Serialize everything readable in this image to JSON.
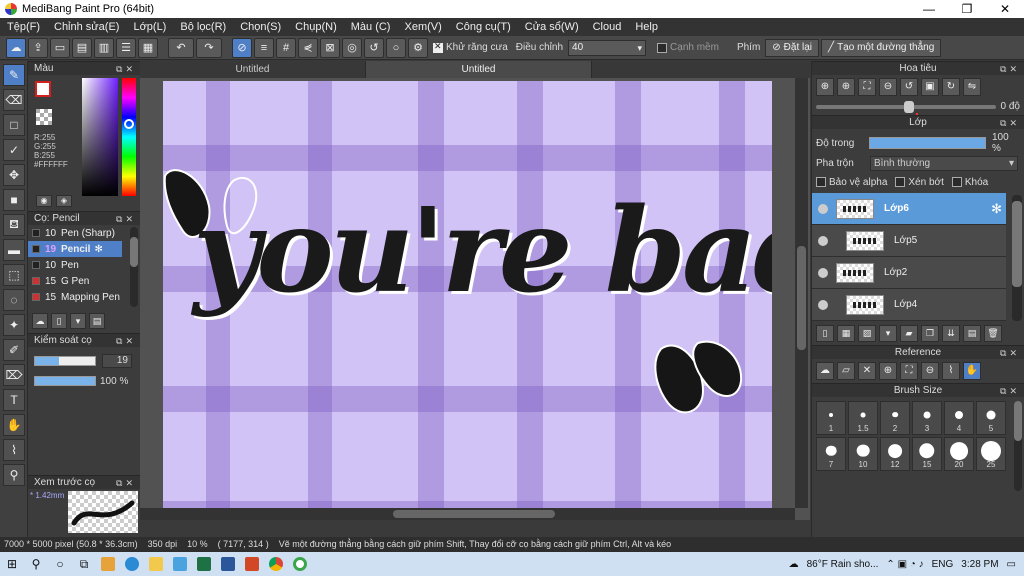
{
  "window": {
    "title": "MediBang Paint Pro (64bit)",
    "controls": [
      "—",
      "❐",
      "✕"
    ]
  },
  "menu": [
    "Tệp(F)",
    "Chỉnh sửa(E)",
    "Lớp(L)",
    "Bộ lọc(R)",
    "Chọn(S)",
    "Chụp(N)",
    "Màu (C)",
    "Xem(V)",
    "Công cụ(T)",
    "Cửa sổ(W)",
    "Cloud",
    "Help"
  ],
  "toolbar": {
    "antialias_label": "Khử răng cưa",
    "adjust_label": "Điều chỉnh",
    "adjust_value": "40",
    "soft_edge_label": "Cạnh mềm",
    "key_label": "Phím",
    "reset_label": "Đặt lại",
    "straight_line_label": "Tạo một đường thẳng"
  },
  "color_panel": {
    "title": "Màu",
    "rgb_r": "R:255",
    "rgb_g": "G:255",
    "rgb_b": "B:255",
    "hex": "#FFFFFF"
  },
  "brush_panel": {
    "title": "Cọ: Pencil",
    "items": [
      {
        "size": "10",
        "name": "Pen (Sharp)",
        "color": "#222222",
        "selected": false
      },
      {
        "size": "19",
        "name": "Pencil",
        "color": "#222222",
        "selected": true
      },
      {
        "size": "10",
        "name": "Pen",
        "color": "#222222",
        "selected": false
      },
      {
        "size": "15",
        "name": "G Pen",
        "color": "#d03030",
        "selected": false
      },
      {
        "size": "15",
        "name": "Mapping Pen",
        "color": "#d03030",
        "selected": false
      }
    ]
  },
  "brush_control": {
    "title": "Kiểm soát cọ",
    "size_value": "19",
    "size_fraction": 0.4,
    "opacity_value": "100 %",
    "opacity_fraction": 1.0
  },
  "preview_panel": {
    "title": "Xem trước cọ",
    "size_text": "* 1.42mm"
  },
  "tabs": [
    "Untitled",
    "Untitled"
  ],
  "canvas": {
    "artwork_text": "you're bad"
  },
  "navigator": {
    "title": "Hoa tiêu",
    "rotation": "0 độ"
  },
  "layer_panel": {
    "title": "Lớp",
    "opacity_label": "Độ trong",
    "opacity_value": "100 %",
    "blend_label": "Pha trộn",
    "blend_value": "Bình thường",
    "protect_alpha": "Bảo vệ alpha",
    "clipping": "Xén bớt",
    "lock": "Khóa",
    "layers": [
      {
        "name": "Lớp6",
        "selected": true,
        "indent": false
      },
      {
        "name": "Lớp5",
        "selected": false,
        "indent": true
      },
      {
        "name": "Lớp2",
        "selected": false,
        "indent": false
      },
      {
        "name": "Lớp4",
        "selected": false,
        "indent": true
      }
    ]
  },
  "reference_panel": {
    "title": "Reference"
  },
  "brush_size_panel": {
    "title": "Brush Size",
    "sizes": [
      "1",
      "1.5",
      "2",
      "3",
      "4",
      "5",
      "7",
      "10",
      "12",
      "15",
      "20",
      "25"
    ]
  },
  "status": {
    "canvas_size": "7000 * 5000 pixel",
    "canvas_cm": "(50.8 * 36.3cm)",
    "dpi": "350 dpi",
    "zoom": "10 %",
    "cursor": "( 7177, 314 )",
    "hint": "Vẽ một đường thẳng bằng cách giữ phím Shift, Thay đổi cỡ cọ bằng cách giữ phím Ctrl, Alt và kéo"
  },
  "taskbar": {
    "weather": "86°F  Rain sho...",
    "language": "ENG",
    "time": "3:28 PM"
  }
}
